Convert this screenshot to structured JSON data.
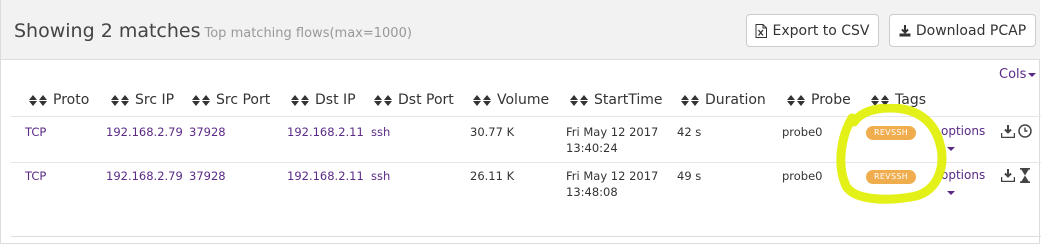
{
  "header": {
    "title": "Showing 2 matches",
    "subtitle": "Top matching flows(max=1000)"
  },
  "toolbar": {
    "export_label": "Export to CSV",
    "download_label": "Download PCAP"
  },
  "cols_label": "Cols",
  "columns": [
    "Proto",
    "Src IP",
    "Src Port",
    "Dst IP",
    "Dst Port",
    "Volume",
    "StartTime",
    "Duration",
    "Probe",
    "Tags"
  ],
  "rows": [
    {
      "proto": "TCP",
      "src_ip": "192.168.2.79",
      "src_port": "37928",
      "dst_ip": "192.168.2.11",
      "dst_port": "ssh",
      "volume": "30.77 K",
      "start_date": "Fri May 12 2017",
      "start_time": "13:40:24",
      "duration": "42 s",
      "probe": "probe0",
      "tag": "REVSSH",
      "options": "options",
      "status_icon": "clock-icon"
    },
    {
      "proto": "TCP",
      "src_ip": "192.168.2.79",
      "src_port": "37928",
      "dst_ip": "192.168.2.11",
      "dst_port": "ssh",
      "volume": "26.11 K",
      "start_date": "Fri May 12 2017",
      "start_time": "13:48:08",
      "duration": "49 s",
      "probe": "probe0",
      "tag": "REVSSH",
      "options": "options",
      "status_icon": "hourglass-icon"
    }
  ],
  "colors": {
    "link": "#5b2a86",
    "tag": "#f0ad4e",
    "highlight": "#e0f000"
  }
}
